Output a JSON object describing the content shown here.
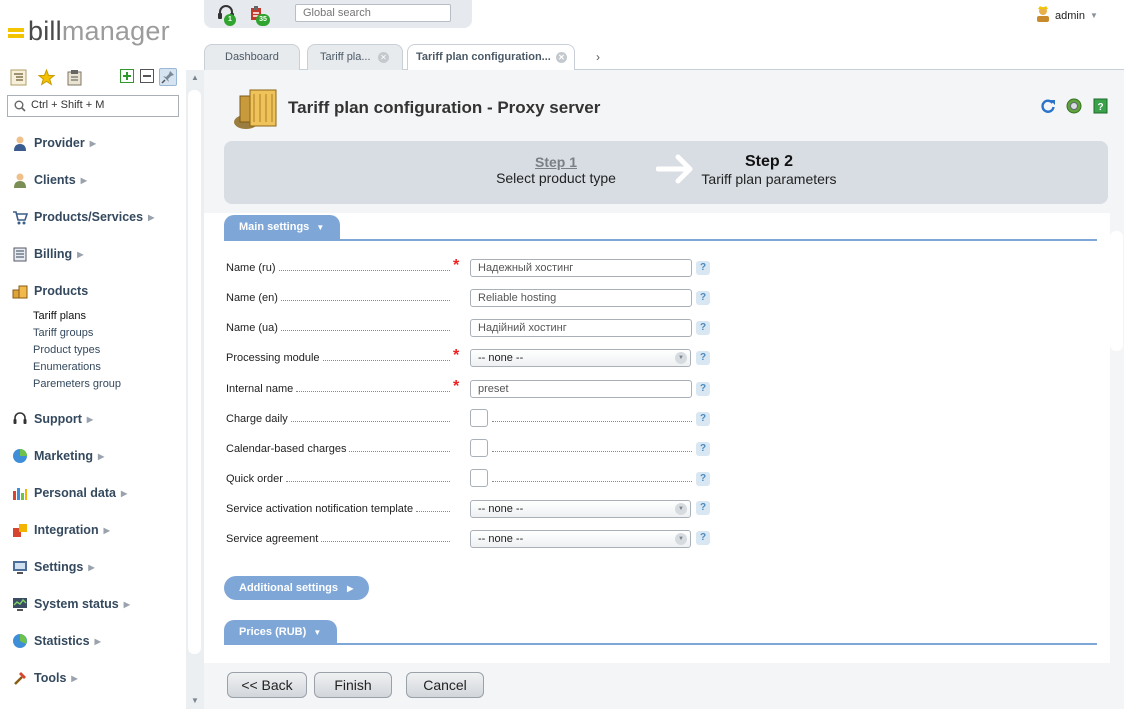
{
  "app": {
    "logo_bill": "bill",
    "logo_manager": "manager"
  },
  "topbar": {
    "support_badge": "1",
    "tasks_badge": "35",
    "search_placeholder": "Global search",
    "user": "admin"
  },
  "sidebar": {
    "search_placeholder": "Ctrl + Shift + M",
    "menu": [
      {
        "label": "Provider",
        "icon": "provider-icon"
      },
      {
        "label": "Clients",
        "icon": "clients-icon"
      },
      {
        "label": "Products/Services",
        "icon": "cart-icon"
      },
      {
        "label": "Billing",
        "icon": "billing-icon"
      },
      {
        "label": "Products",
        "icon": "products-icon"
      },
      {
        "label": "Support",
        "icon": "headset-icon"
      },
      {
        "label": "Marketing",
        "icon": "marketing-icon"
      },
      {
        "label": "Personal data",
        "icon": "chart-icon"
      },
      {
        "label": "Integration",
        "icon": "integration-icon"
      },
      {
        "label": "Settings",
        "icon": "settings-icon"
      },
      {
        "label": "System status",
        "icon": "monitor-icon"
      },
      {
        "label": "Statistics",
        "icon": "statistics-icon"
      },
      {
        "label": "Tools",
        "icon": "tools-icon"
      }
    ],
    "products_sub": [
      "Tariff plans",
      "Tariff groups",
      "Product types",
      "Enumerations",
      "Paremeters group"
    ]
  },
  "tabs": [
    {
      "label": "Dashboard"
    },
    {
      "label": "Tariff pla..."
    },
    {
      "label": "Tariff plan configuration..."
    }
  ],
  "page": {
    "title": "Tariff plan configuration - Proxy server",
    "step1_num": "Step 1",
    "step1_text": "Select product type",
    "step2_num": "Step 2",
    "step2_text": "Tariff plan parameters"
  },
  "form": {
    "main_settings": "Main settings",
    "additional_settings": "Additional settings",
    "prices": "Prices (RUB)",
    "fields": {
      "name_ru": {
        "label": "Name (ru)",
        "value": "Надежный хостинг"
      },
      "name_en": {
        "label": "Name (en)",
        "value": "Reliable hosting"
      },
      "name_ua": {
        "label": "Name (ua)",
        "value": "Надійний хостинг"
      },
      "processing_module": {
        "label": "Processing module",
        "value": "-- none --"
      },
      "internal_name": {
        "label": "Internal name",
        "value": "preset"
      },
      "charge_daily": {
        "label": "Charge daily"
      },
      "calendar_charges": {
        "label": "Calendar-based charges"
      },
      "quick_order": {
        "label": "Quick order"
      },
      "activation_template": {
        "label": "Service activation notification template",
        "value": "-- none --"
      },
      "agreement": {
        "label": "Service agreement",
        "value": "-- none --"
      }
    },
    "help": "?"
  },
  "buttons": {
    "back": "<< Back",
    "finish": "Finish",
    "cancel": "Cancel"
  }
}
